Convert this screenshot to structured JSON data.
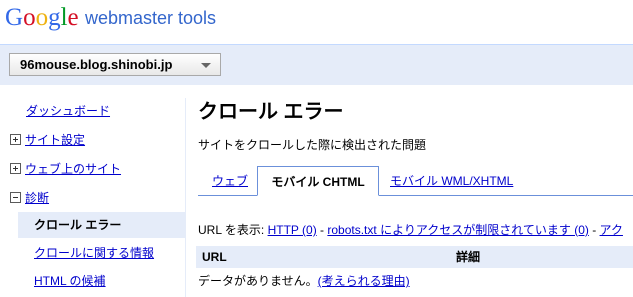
{
  "header": {
    "logo_letters": [
      {
        "ch": "G",
        "color": "#3369e8"
      },
      {
        "ch": "o",
        "color": "#d50f25"
      },
      {
        "ch": "o",
        "color": "#eeb211"
      },
      {
        "ch": "g",
        "color": "#3369e8"
      },
      {
        "ch": "l",
        "color": "#009925"
      },
      {
        "ch": "e",
        "color": "#d50f25"
      }
    ],
    "product": "webmaster tools"
  },
  "site_selector": {
    "value": "96mouse.blog.shinobi.jp"
  },
  "sidebar": {
    "dashboard": "ダッシュボード",
    "groups": [
      {
        "label": "サイト設定",
        "expanded": false
      },
      {
        "label": "ウェブ上のサイト",
        "expanded": false
      },
      {
        "label": "診断",
        "expanded": true
      }
    ],
    "sub_items": [
      {
        "label": "クロール エラー",
        "active": true
      },
      {
        "label": "クロールに関する情報",
        "active": false
      },
      {
        "label": "HTML の候補",
        "active": false
      }
    ]
  },
  "main": {
    "title": "クロール エラー",
    "description": "サイトをクロールした際に検出された問題",
    "tabs": [
      {
        "label": "ウェブ",
        "active": false
      },
      {
        "label": "モバイル CHTML",
        "active": true
      },
      {
        "label": "モバイル WML/XHTML",
        "active": false
      }
    ],
    "filter": {
      "prefix": "URL を表示: ",
      "http": "HTTP (0)",
      "sep1": " - ",
      "robots": "robots.txt によりアクセスが制限されています (0)",
      "sep2": " - ",
      "more": "アク"
    },
    "table": {
      "columns": [
        "URL",
        "詳細"
      ],
      "empty_text": "データがありません。",
      "reasons_link": "(考えられる理由)"
    }
  }
}
